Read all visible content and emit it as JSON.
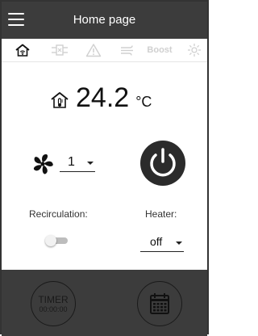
{
  "header": {
    "title": "Home page",
    "menu_icon": "hamburger-menu-icon",
    "background": "#3c3c3c"
  },
  "tabs": [
    {
      "name": "home",
      "icon": "home-wifi-icon",
      "active": true
    },
    {
      "name": "ventilation",
      "icon": "ventilation-unit-icon",
      "active": false
    },
    {
      "name": "alarm",
      "icon": "warning-icon",
      "active": false
    },
    {
      "name": "airflow",
      "icon": "air-flow-icon",
      "active": false
    },
    {
      "name": "boost",
      "label": "Boost",
      "active": false
    },
    {
      "name": "summer",
      "icon": "sun-icon",
      "active": false
    }
  ],
  "reading": {
    "icon": "house-thermometer-icon",
    "temperature": "24.2",
    "unit": "°C"
  },
  "fan": {
    "icon": "fan-icon",
    "speed": "1"
  },
  "power": {
    "icon": "power-icon",
    "state": "on"
  },
  "recirculation": {
    "label": "Recirculation:",
    "enabled": false
  },
  "heater": {
    "label": "Heater:",
    "value": "off"
  },
  "footer": {
    "timer_label": "TIMER",
    "timer_value": "00:00:00",
    "schedule_icon": "weekly-schedule-icon"
  },
  "colors": {
    "dark": "#3c3c3c",
    "inactive_icon": "#d0d0d0",
    "text": "#111111"
  }
}
